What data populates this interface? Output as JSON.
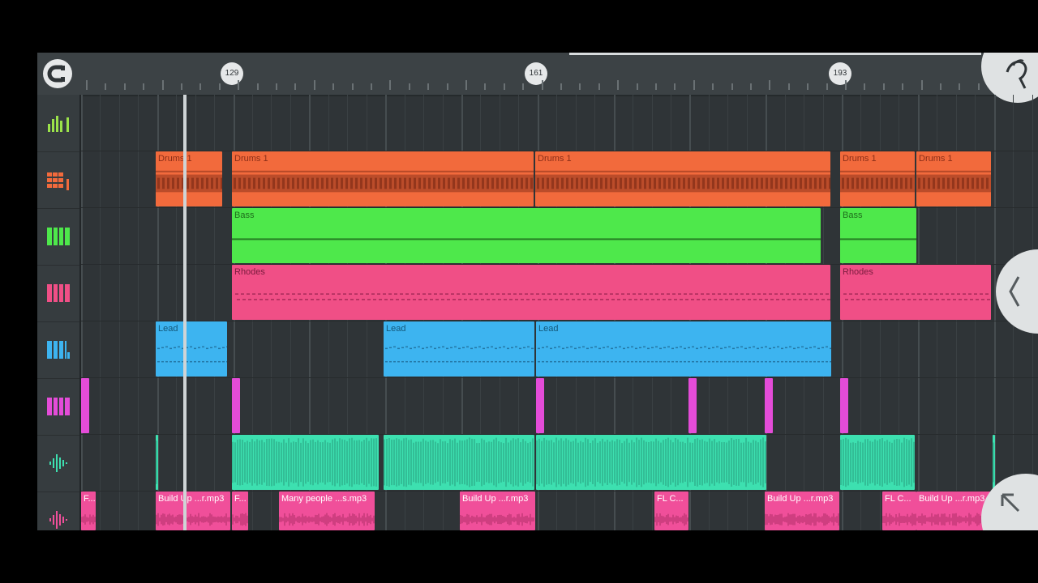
{
  "ruler": {
    "markers": [
      {
        "id": "m129",
        "label": "129"
      },
      {
        "id": "m161",
        "label": "161"
      },
      {
        "id": "m193",
        "label": "193"
      }
    ]
  },
  "tracks": [
    {
      "name": "track-meter",
      "icon": "level-meter-icon",
      "color": "#9be24a"
    },
    {
      "name": "track-drums",
      "icon": "drum-pads-icon",
      "color": "#f26a3c"
    },
    {
      "name": "track-bass",
      "icon": "piano-roll-icon",
      "color": "#4ee84b"
    },
    {
      "name": "track-rhodes",
      "icon": "piano-roll-icon",
      "color": "#f04f86"
    },
    {
      "name": "track-lead",
      "icon": "piano-roll-icon",
      "color": "#3db4f0"
    },
    {
      "name": "track-perc",
      "icon": "piano-roll-icon",
      "color": "#e44cd8"
    },
    {
      "name": "track-audio-1",
      "icon": "waveform-icon",
      "color": "#3de0b0"
    },
    {
      "name": "track-audio-2",
      "icon": "waveform-icon",
      "color": "#f04f9a"
    }
  ],
  "clips": {
    "drums": [
      "Drums 1",
      "Drums 1",
      "Drums 1",
      "Drums 1",
      "Drums 1"
    ],
    "bass": [
      "Bass",
      "Bass"
    ],
    "rhodes": [
      "Rhodes",
      "Rhodes"
    ],
    "lead": [
      "Lead",
      "Lead",
      "Lead"
    ],
    "audio2": [
      "F...",
      "Build Up ...r.mp3",
      "F...",
      "Many people ...s.mp3",
      "Build Up ...r.mp3",
      "FL C...",
      "Build Up ...r.mp3",
      "FL C...",
      "Build Up ...r.mp3"
    ]
  },
  "colors": {
    "drums": "#f26a3c",
    "bass": "#4ee84b",
    "rhodes": "#f04f86",
    "lead": "#3db4f0",
    "perc": "#e44cd8",
    "audio1": "#3de0b0",
    "audio2": "#f04f9a"
  }
}
